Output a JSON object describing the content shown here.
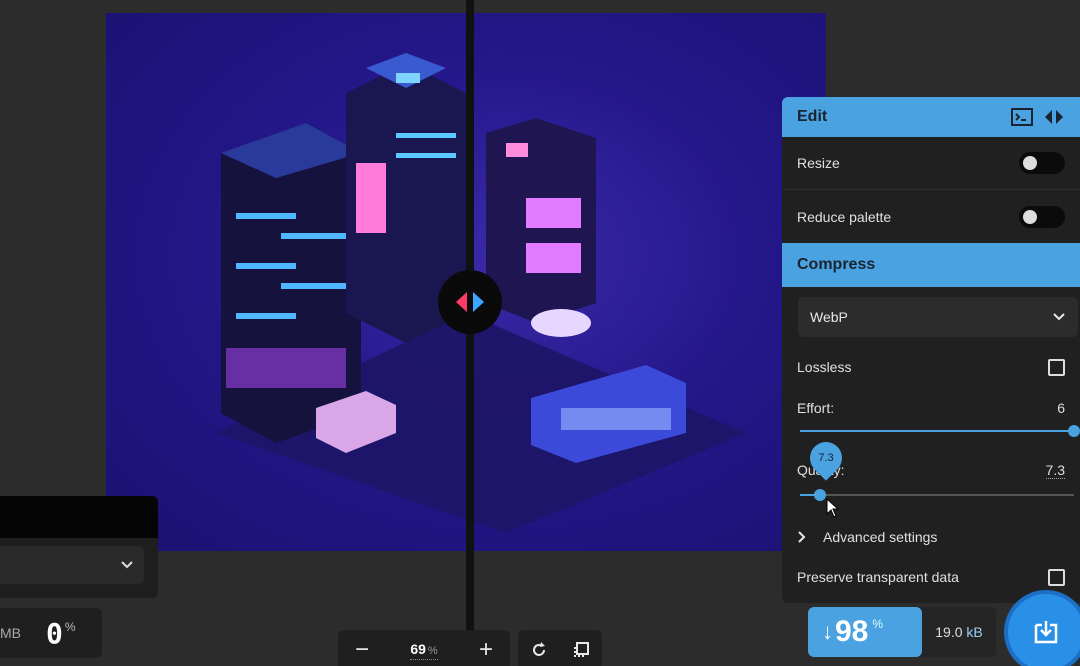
{
  "canvas": {
    "image_label": "isometric neon city scene"
  },
  "left_panel": {
    "size_unit": "MB",
    "percent": "0",
    "percent_symbol": "%"
  },
  "zoom": {
    "minus": "−",
    "value": "69",
    "unit": "%",
    "plus": "+"
  },
  "edit": {
    "title": "Edit",
    "resize_label": "Resize",
    "reduce_palette_label": "Reduce palette"
  },
  "compress": {
    "title": "Compress",
    "format": "WebP",
    "lossless_label": "Lossless",
    "effort_label": "Effort:",
    "effort_value": "6",
    "effort_fraction": 1.0,
    "quality_label": "Quality:",
    "quality_value": "7.3",
    "quality_fraction": 0.073,
    "advanced_label": "Advanced settings",
    "preserve_label": "Preserve transparent data"
  },
  "result": {
    "arrow": "↓",
    "percent": "98",
    "percent_symbol": "%",
    "size_value": "19.0",
    "size_unit": "kB"
  },
  "colors": {
    "accent": "#4aa3e0",
    "panel": "#202020",
    "background": "#2c2c2c"
  }
}
